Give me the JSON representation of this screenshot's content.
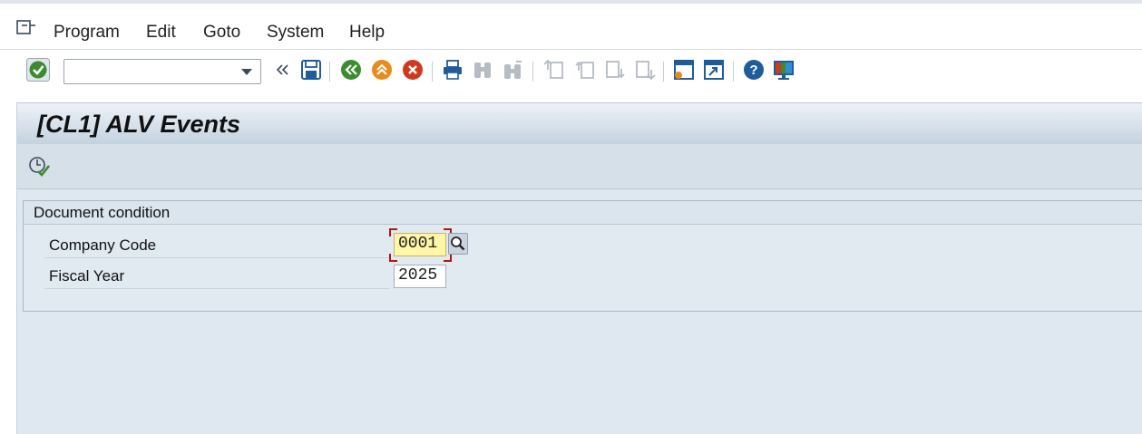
{
  "menu": {
    "items": [
      {
        "label": "Program"
      },
      {
        "label": "Edit"
      },
      {
        "label": "Goto"
      },
      {
        "label": "System"
      },
      {
        "label": "Help"
      }
    ]
  },
  "toolbar": {
    "command_field_value": "",
    "icons": [
      "enter-icon",
      "command-dropdown",
      "collapse-icon",
      "save-icon",
      "back-icon",
      "exit-icon",
      "cancel-icon",
      "print-icon",
      "find-icon",
      "find-next-icon",
      "first-page-icon",
      "previous-page-icon",
      "next-page-icon",
      "last-page-icon",
      "create-session-icon",
      "shortcut-icon",
      "help-icon",
      "customize-layout-icon"
    ],
    "colors": {
      "green": "#3c8b2f",
      "orange": "#e98a1c",
      "red": "#cf3a1e",
      "blue": "#1f5c9a"
    }
  },
  "screen": {
    "title": "[CL1] ALV Events",
    "execute_icon": "execute-icon"
  },
  "selection": {
    "group_title": "Document condition",
    "company_code": {
      "label": "Company Code",
      "value": "0001"
    },
    "fiscal_year": {
      "label": "Fiscal Year",
      "value": "2025"
    }
  }
}
